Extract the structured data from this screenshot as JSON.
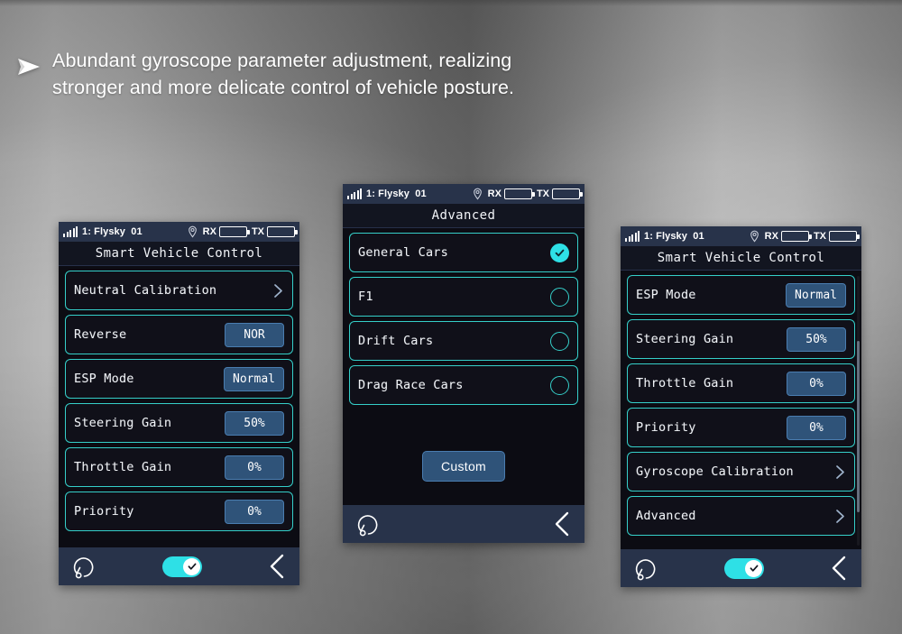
{
  "headline": {
    "bullet_icon": "arrow-bullet-icon",
    "text": "Abundant gyroscope parameter adjustment, realizing\nstronger and more delicate control of vehicle posture."
  },
  "colors": {
    "accent_cyan": "#35cfc9",
    "toggle_on": "#2ee0e6",
    "pill_blue": "#2f5379",
    "pill_border": "#4a7db0",
    "bar_navy": "#28334a",
    "screen_bg": "#0c0c13"
  },
  "status_bar": {
    "signal_icon": "signal-bars-icon",
    "model": "1: Flysky  01",
    "location_icon": "location-pin-icon",
    "rx_label": "RX",
    "tx_label": "TX"
  },
  "screens": [
    {
      "id": "left",
      "title": "Smart Vehicle Control",
      "rows": [
        {
          "label": "Neutral Calibration",
          "control": "chevron"
        },
        {
          "label": "Reverse",
          "control": "pill",
          "value": "NOR"
        },
        {
          "label": "ESP Mode",
          "control": "pill",
          "value": "Normal"
        },
        {
          "label": "Steering Gain",
          "control": "pill",
          "value": "50%"
        },
        {
          "label": "Throttle Gain",
          "control": "pill",
          "value": "0%"
        },
        {
          "label": "Priority",
          "control": "pill",
          "value": "0%"
        }
      ],
      "bottom_bar": {
        "undo_icon": "undo-reset-icon",
        "toggle": {
          "icon": "check-icon",
          "state": "on"
        },
        "back_icon": "back-chevron-icon"
      }
    },
    {
      "id": "middle",
      "title": "Advanced",
      "rows": [
        {
          "label": "General Cars",
          "control": "radio",
          "selected": true
        },
        {
          "label": "F1",
          "control": "radio",
          "selected": false
        },
        {
          "label": "Drift Cars",
          "control": "radio",
          "selected": false
        },
        {
          "label": "Drag Race Cars",
          "control": "radio",
          "selected": false
        }
      ],
      "custom_button": "Custom",
      "bottom_bar": {
        "undo_icon": "undo-reset-icon",
        "back_icon": "back-chevron-icon"
      }
    },
    {
      "id": "right",
      "title": "Smart Vehicle Control",
      "rows": [
        {
          "label": "ESP Mode",
          "control": "pill",
          "value": "Normal"
        },
        {
          "label": "Steering Gain",
          "control": "pill",
          "value": "50%"
        },
        {
          "label": "Throttle Gain",
          "control": "pill",
          "value": "0%"
        },
        {
          "label": "Priority",
          "control": "pill",
          "value": "0%"
        },
        {
          "label": "Gyroscope Calibration",
          "control": "chevron"
        },
        {
          "label": "Advanced",
          "control": "chevron"
        }
      ],
      "scrollbar": {
        "visible": true
      },
      "bottom_bar": {
        "undo_icon": "undo-reset-icon",
        "toggle": {
          "icon": "check-icon",
          "state": "on"
        },
        "back_icon": "back-chevron-icon"
      }
    }
  ]
}
